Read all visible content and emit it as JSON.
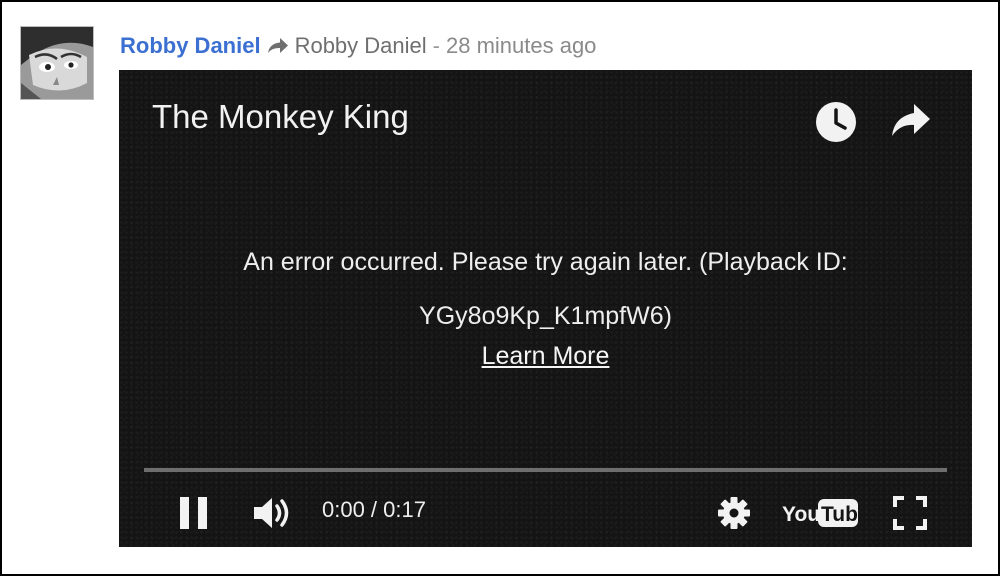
{
  "post": {
    "author": "Robby Daniel",
    "share_target": "Robby Daniel",
    "separator": "-",
    "time": "28 minutes ago"
  },
  "player": {
    "title": "The Monkey King",
    "error_message": "An error occurred. Please try again later. (Playback ID: YGy8o9Kp_K1mpfW6)",
    "learn_more": "Learn More",
    "time_display": "0:00 / 0:17",
    "progress": 0,
    "logo_you": "You",
    "logo_tube": "Tube"
  },
  "icons": {
    "avatar": "avatar-photo",
    "share_arrow": "share-arrow-icon",
    "clock": "clock-icon",
    "share": "share-icon",
    "pause": "pause-icon",
    "volume": "volume-icon",
    "settings": "gear-icon",
    "fullscreen": "fullscreen-icon"
  },
  "colors": {
    "author": "#3b6fd1",
    "player_bg": "#141414",
    "progress_track": "#6e6e6e",
    "progress_fill": "#cc181e"
  }
}
